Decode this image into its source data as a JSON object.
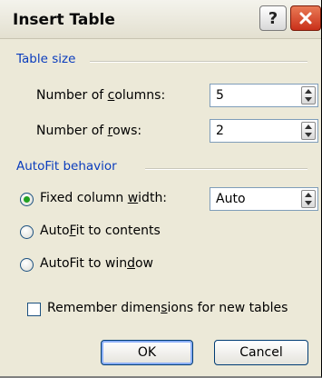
{
  "dialog": {
    "title": "Insert Table",
    "help_glyph": "?",
    "close_glyph": "✕"
  },
  "table_size": {
    "heading": "Table size",
    "columns_label_pre": "Number of ",
    "columns_label_u": "c",
    "columns_label_post": "olumns:",
    "columns_value": "5",
    "rows_label_pre": "Number of ",
    "rows_label_u": "r",
    "rows_label_post": "ows:",
    "rows_value": "2"
  },
  "autofit": {
    "heading": "AutoFit behavior",
    "fixed_label_pre": "Fixed column ",
    "fixed_label_u": "w",
    "fixed_label_post": "idth:",
    "fixed_value": "Auto",
    "fixed_selected": true,
    "contents_label_pre": "Auto",
    "contents_label_u": "F",
    "contents_label_post": "it to contents",
    "window_label_pre": "AutoFit to win",
    "window_label_u": "d",
    "window_label_post": "ow"
  },
  "remember": {
    "label_pre": "Remember dimen",
    "label_u": "s",
    "label_post": "ions for new tables",
    "checked": false
  },
  "buttons": {
    "ok": "OK",
    "cancel": "Cancel"
  },
  "colors": {
    "section_heading": "#0b3dbd",
    "radio_dot": "#21a121",
    "dialog_bg": "#ece9d8"
  }
}
